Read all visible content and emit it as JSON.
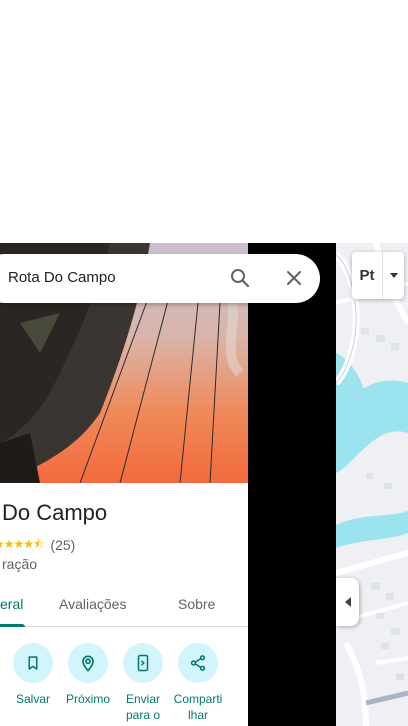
{
  "search": {
    "value": "Rota Do Campo"
  },
  "place": {
    "title": "Do Campo",
    "rating_stars": "★★★★⯪",
    "rating_value": 4.5,
    "review_count": "(25)",
    "category": "ração"
  },
  "tabs": [
    {
      "label": "eral",
      "active": true
    },
    {
      "label": "Avaliações",
      "active": false
    },
    {
      "label": "Sobre",
      "active": false
    }
  ],
  "actions": [
    {
      "label": "Salvar",
      "icon": "bookmark-icon"
    },
    {
      "label": "Próximo",
      "icon": "nearby-icon"
    },
    {
      "label": "Enviar para o",
      "icon": "send-to-phone-icon"
    },
    {
      "label": "Comparti lhar",
      "icon": "share-icon"
    }
  ],
  "map_controls": {
    "layer_label": "Pt"
  },
  "colors": {
    "accent": "#00796b",
    "action_bg": "#d2f5fb",
    "star": "#fbbc04",
    "water": "#9ce3f0",
    "map_bg": "#eef0f3"
  }
}
